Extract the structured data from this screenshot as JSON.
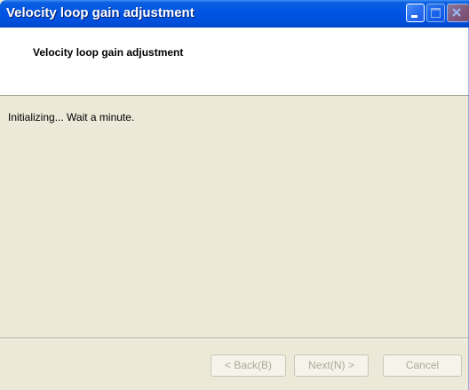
{
  "window": {
    "title": "Velocity loop gain adjustment"
  },
  "titlebar_buttons": {
    "minimize_icon": "minimize-icon",
    "maximize_icon": "maximize-icon",
    "close_icon": "close-icon"
  },
  "header": {
    "title": "Velocity loop gain adjustment"
  },
  "content": {
    "status": "Initializing... Wait a minute."
  },
  "buttons": {
    "back_label": "< Back(B)",
    "next_label": "Next(N) >",
    "cancel_label": "Cancel",
    "disabled_color": "#aca899"
  },
  "colors": {
    "titlebar": "#0054e3",
    "dialog_face": "#ece9d8",
    "header_bg": "#ffffff"
  }
}
